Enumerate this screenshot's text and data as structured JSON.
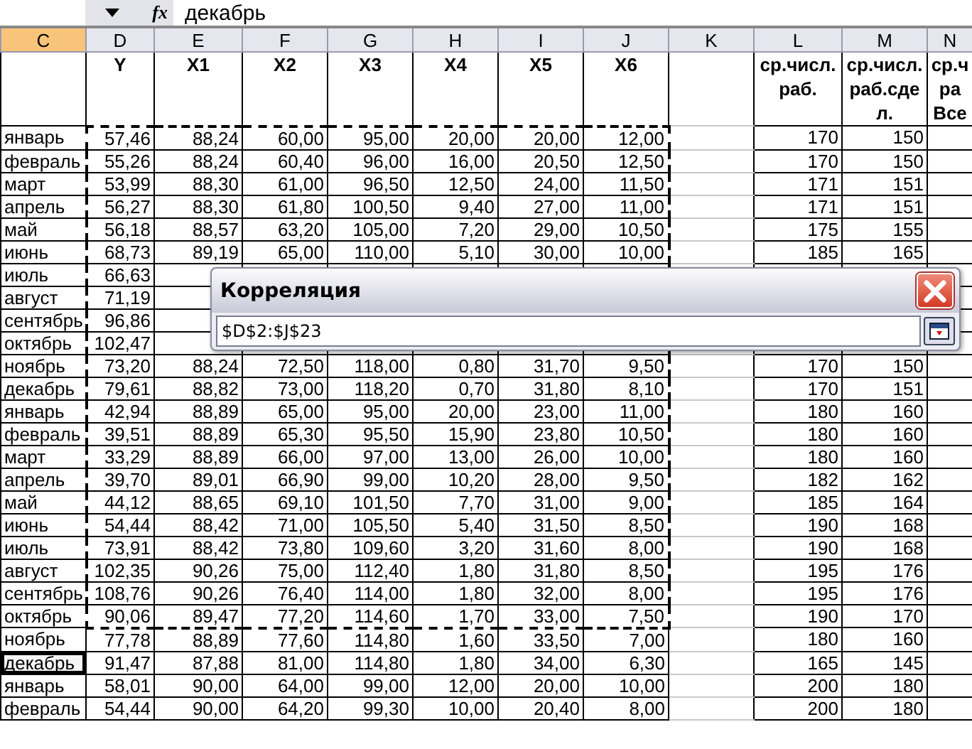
{
  "formula_bar": {
    "function_label": "fx",
    "value": "декабрь"
  },
  "columns": [
    {
      "letter": "C",
      "selected": true
    },
    {
      "letter": "D",
      "label": [
        "Y"
      ],
      "selected": false
    },
    {
      "letter": "E",
      "label": [
        "X1"
      ],
      "selected": false
    },
    {
      "letter": "F",
      "label": [
        "X2"
      ],
      "selected": false
    },
    {
      "letter": "G",
      "label": [
        "X3"
      ],
      "selected": false
    },
    {
      "letter": "H",
      "label": [
        "X4"
      ],
      "selected": false
    },
    {
      "letter": "I",
      "label": [
        "X5"
      ],
      "selected": false
    },
    {
      "letter": "J",
      "label": [
        "X6"
      ],
      "selected": false
    },
    {
      "letter": "K",
      "selected": false
    },
    {
      "letter": "L",
      "label": [
        "ср.числ.",
        "раб."
      ],
      "selected": false
    },
    {
      "letter": "M",
      "label": [
        "ср.числ.",
        "раб.сде",
        "л."
      ],
      "selected": false
    },
    {
      "letter": "N",
      "label": [
        "ср.ч",
        "ра",
        "Все"
      ],
      "selected": false
    }
  ],
  "rows": [
    {
      "month": "январь",
      "selected": false,
      "marked": true,
      "cells": {
        "D": "57,46",
        "E": "88,24",
        "F": "60,00",
        "G": "95,00",
        "H": "20,00",
        "I": "20,00",
        "J": "12,00",
        "L": "170",
        "M": "150"
      }
    },
    {
      "month": "февраль",
      "selected": false,
      "marked": true,
      "cells": {
        "D": "55,26",
        "E": "88,24",
        "F": "60,40",
        "G": "96,00",
        "H": "16,00",
        "I": "20,50",
        "J": "12,50",
        "L": "170",
        "M": "150"
      }
    },
    {
      "month": "март",
      "selected": false,
      "marked": true,
      "cells": {
        "D": "53,99",
        "E": "88,30",
        "F": "61,00",
        "G": "96,50",
        "H": "12,50",
        "I": "24,00",
        "J": "11,50",
        "L": "171",
        "M": "151"
      }
    },
    {
      "month": "апрель",
      "selected": false,
      "marked": true,
      "cells": {
        "D": "56,27",
        "E": "88,30",
        "F": "61,80",
        "G": "100,50",
        "H": "9,40",
        "I": "27,00",
        "J": "11,00",
        "L": "171",
        "M": "151"
      }
    },
    {
      "month": "май",
      "selected": false,
      "marked": true,
      "cells": {
        "D": "56,18",
        "E": "88,57",
        "F": "63,20",
        "G": "105,00",
        "H": "7,20",
        "I": "29,00",
        "J": "10,50",
        "L": "175",
        "M": "155"
      }
    },
    {
      "month": "июнь",
      "selected": false,
      "marked": true,
      "cells": {
        "D": "68,73",
        "E": "89,19",
        "F": "65,00",
        "G": "110,00",
        "H": "5,10",
        "I": "30,00",
        "J": "10,00",
        "L": "185",
        "M": "165"
      }
    },
    {
      "month": "июль",
      "selected": false,
      "marked": true,
      "cells": {
        "D": "66,63"
      }
    },
    {
      "month": "август",
      "selected": false,
      "marked": true,
      "cells": {
        "D": "71,19"
      }
    },
    {
      "month": "сентябрь",
      "selected": false,
      "marked": true,
      "cells": {
        "D": "96,86"
      }
    },
    {
      "month": "октябрь",
      "selected": false,
      "marked": true,
      "cells": {
        "D": "102,47"
      }
    },
    {
      "month": "ноябрь",
      "selected": false,
      "marked": true,
      "cells": {
        "D": "73,20",
        "E": "88,24",
        "F": "72,50",
        "G": "118,00",
        "H": "0,80",
        "I": "31,70",
        "J": "9,50",
        "L": "170",
        "M": "150"
      }
    },
    {
      "month": "декабрь",
      "selected": false,
      "marked": true,
      "cells": {
        "D": "79,61",
        "E": "88,82",
        "F": "73,00",
        "G": "118,20",
        "H": "0,70",
        "I": "31,80",
        "J": "8,10",
        "L": "170",
        "M": "151"
      }
    },
    {
      "month": "январь",
      "selected": false,
      "marked": true,
      "cells": {
        "D": "42,94",
        "E": "88,89",
        "F": "65,00",
        "G": "95,00",
        "H": "20,00",
        "I": "23,00",
        "J": "11,00",
        "L": "180",
        "M": "160"
      }
    },
    {
      "month": "февраль",
      "selected": false,
      "marked": true,
      "cells": {
        "D": "39,51",
        "E": "88,89",
        "F": "65,30",
        "G": "95,50",
        "H": "15,90",
        "I": "23,80",
        "J": "10,50",
        "L": "180",
        "M": "160"
      }
    },
    {
      "month": "март",
      "selected": false,
      "marked": true,
      "cells": {
        "D": "33,29",
        "E": "88,89",
        "F": "66,00",
        "G": "97,00",
        "H": "13,00",
        "I": "26,00",
        "J": "10,00",
        "L": "180",
        "M": "160"
      }
    },
    {
      "month": "апрель",
      "selected": false,
      "marked": true,
      "cells": {
        "D": "39,70",
        "E": "89,01",
        "F": "66,90",
        "G": "99,00",
        "H": "10,20",
        "I": "28,00",
        "J": "9,50",
        "L": "182",
        "M": "162"
      }
    },
    {
      "month": "май",
      "selected": false,
      "marked": true,
      "cells": {
        "D": "44,12",
        "E": "88,65",
        "F": "69,10",
        "G": "101,50",
        "H": "7,70",
        "I": "31,00",
        "J": "9,00",
        "L": "185",
        "M": "164"
      }
    },
    {
      "month": "июнь",
      "selected": false,
      "marked": true,
      "cells": {
        "D": "54,44",
        "E": "88,42",
        "F": "71,00",
        "G": "105,50",
        "H": "5,40",
        "I": "31,50",
        "J": "8,50",
        "L": "190",
        "M": "168"
      }
    },
    {
      "month": "июль",
      "selected": false,
      "marked": true,
      "cells": {
        "D": "73,91",
        "E": "88,42",
        "F": "73,80",
        "G": "109,60",
        "H": "3,20",
        "I": "31,60",
        "J": "8,00",
        "L": "190",
        "M": "168"
      }
    },
    {
      "month": "август",
      "selected": false,
      "marked": true,
      "cells": {
        "D": "102,35",
        "E": "90,26",
        "F": "75,00",
        "G": "112,40",
        "H": "1,80",
        "I": "31,80",
        "J": "8,50",
        "L": "195",
        "M": "176"
      }
    },
    {
      "month": "сентябрь",
      "selected": false,
      "marked": true,
      "cells": {
        "D": "108,76",
        "E": "90,26",
        "F": "76,40",
        "G": "114,00",
        "H": "1,80",
        "I": "32,00",
        "J": "8,00",
        "L": "195",
        "M": "176"
      }
    },
    {
      "month": "октябрь",
      "selected": false,
      "marked": true,
      "cells": {
        "D": "90,06",
        "E": "89,47",
        "F": "77,20",
        "G": "114,60",
        "H": "1,70",
        "I": "33,00",
        "J": "7,50",
        "L": "190",
        "M": "170"
      }
    },
    {
      "month": "ноябрь",
      "selected": false,
      "marked": false,
      "cells": {
        "D": "77,78",
        "E": "88,89",
        "F": "77,60",
        "G": "114,80",
        "H": "1,60",
        "I": "33,50",
        "J": "7,00",
        "L": "180",
        "M": "160"
      }
    },
    {
      "month": "декабрь",
      "selected": true,
      "marked": false,
      "cells": {
        "D": "91,47",
        "E": "87,88",
        "F": "81,00",
        "G": "114,80",
        "H": "1,80",
        "I": "34,00",
        "J": "6,30",
        "L": "165",
        "M": "145"
      }
    },
    {
      "month": "январь",
      "selected": false,
      "marked": false,
      "cells": {
        "D": "58,01",
        "E": "90,00",
        "F": "64,00",
        "G": "99,00",
        "H": "12,00",
        "I": "20,00",
        "J": "10,00",
        "L": "200",
        "M": "180"
      }
    },
    {
      "month": "февраль",
      "selected": false,
      "marked": false,
      "cells": {
        "D": "54,44",
        "E": "90,00",
        "F": "64,20",
        "G": "99,30",
        "H": "10,00",
        "I": "20,40",
        "J": "8,00",
        "L": "200",
        "M": "180"
      }
    }
  ],
  "dialog": {
    "title": "Корреляция",
    "range": "$D$2:$J$23"
  }
}
